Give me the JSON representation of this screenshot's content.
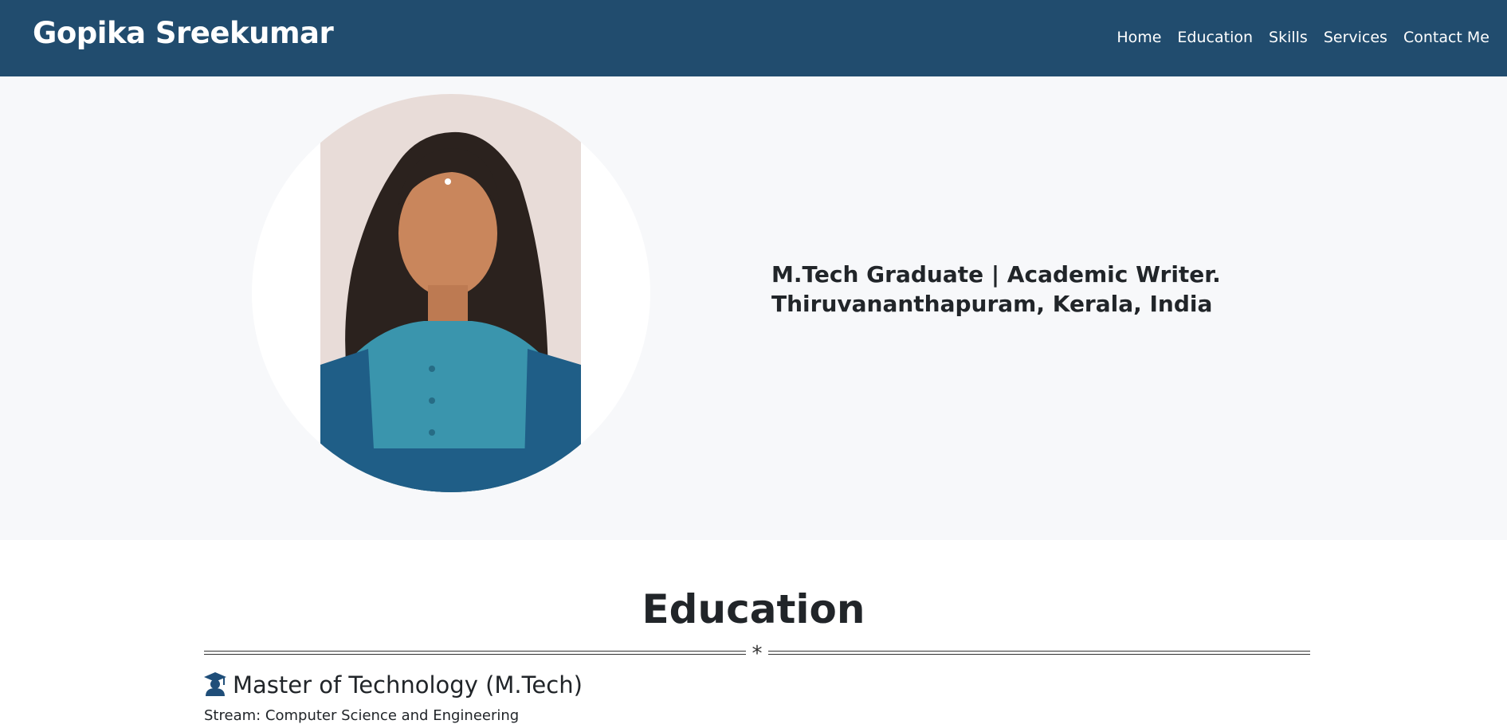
{
  "navbar": {
    "brand": "Gopika Sreekumar",
    "links": [
      {
        "label": "Home"
      },
      {
        "label": "Education"
      },
      {
        "label": "Skills"
      },
      {
        "label": "Services"
      },
      {
        "label": "Contact Me"
      }
    ]
  },
  "hero": {
    "line1": "M.Tech Graduate | Academic Writer.",
    "line2": "Thiruvananthapuram, Kerala, India"
  },
  "education": {
    "title": "Education",
    "divider_symbol": "*",
    "items": [
      {
        "icon": "graduation-cap-icon",
        "title": "Master of Technology (M.Tech)",
        "stream": "Stream: Computer Science and Engineering"
      }
    ]
  },
  "colors": {
    "navbar_bg": "#214c6e",
    "hero_bg": "#f7f8fa",
    "accent_dark_blue": "#1f4e79"
  }
}
